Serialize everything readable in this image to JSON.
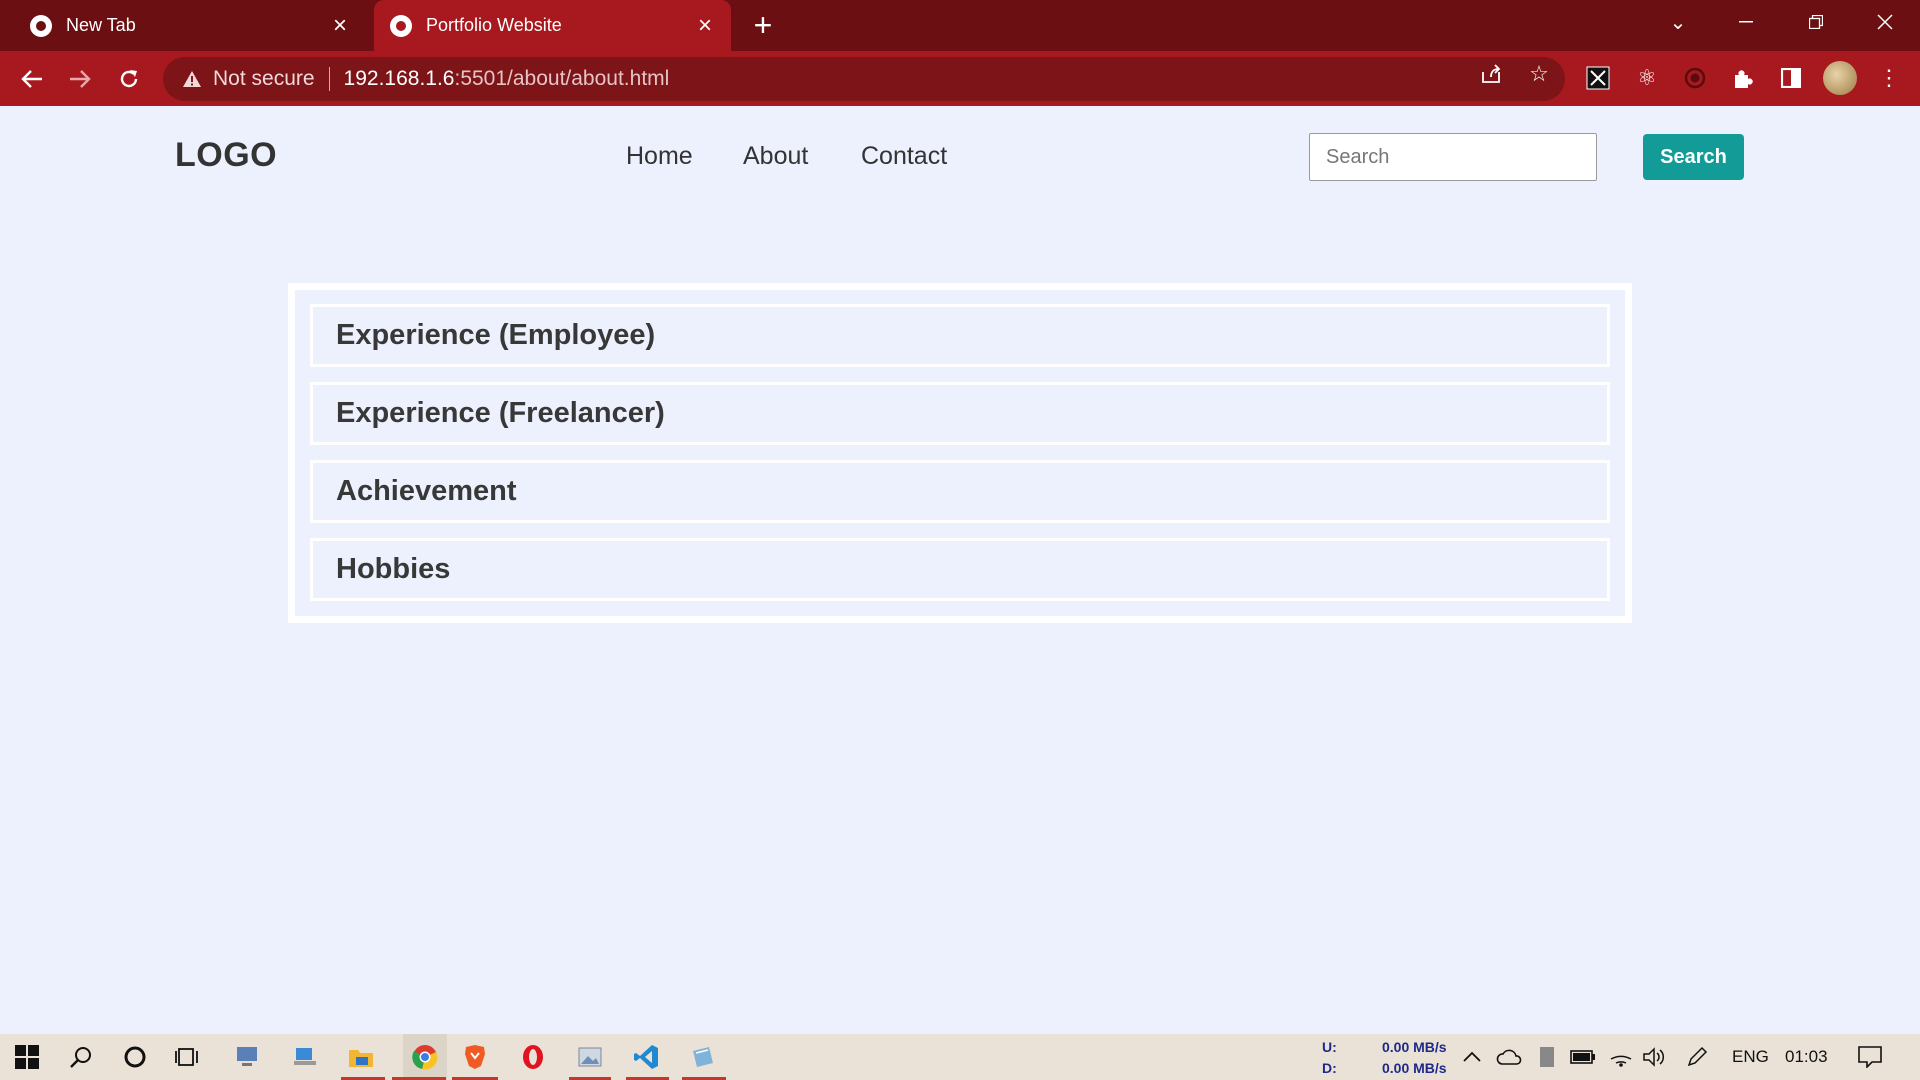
{
  "browser": {
    "tabs": [
      {
        "title": "New Tab",
        "active": false
      },
      {
        "title": "Portfolio Website",
        "active": true
      }
    ],
    "security_label": "Not secure",
    "url_host": "192.168.1.6",
    "url_rest": ":5501/about/about.html"
  },
  "site": {
    "logo": "LOGO",
    "nav": [
      "Home",
      "About",
      "Contact"
    ],
    "search_placeholder": "Search",
    "search_button": "Search"
  },
  "accordion": [
    "Experience (Employee)",
    "Experience (Freelancer)",
    "Achievement",
    "Hobbies"
  ],
  "taskbar": {
    "upload_label": "U:",
    "download_label": "D:",
    "upload_speed": "0.00 MB/s",
    "download_speed": "0.00 MB/s",
    "language": "ENG",
    "time": "01:03"
  },
  "colors": {
    "tabbar": "#6b0f12",
    "toolbar": "#a8191f",
    "page_bg": "#ecf1fd",
    "search_button": "#139b97"
  }
}
